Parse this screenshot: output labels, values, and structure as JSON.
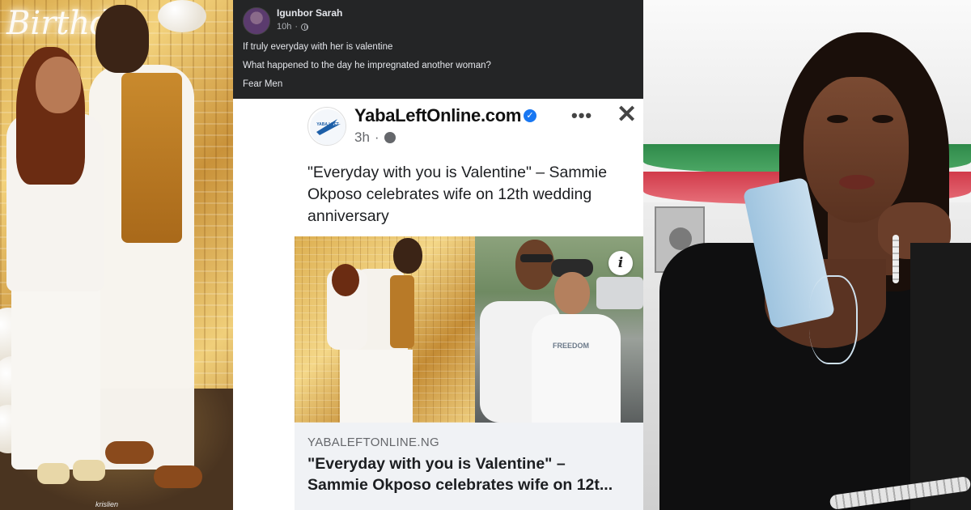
{
  "left_photo": {
    "sign_text": "Birthd",
    "credit": "krislien"
  },
  "facebook_post": {
    "author": "Igunbor Sarah",
    "time": "10h",
    "lines": [
      "If truly everyday with her is valentine",
      "What happened to the day he impregnated another woman?",
      "Fear Men"
    ]
  },
  "shared_post": {
    "page_name": "YabaLeftOnline.com",
    "logo_text": "YABA LEFT",
    "time": "3h",
    "more_icon": "more-dots-icon",
    "close_icon": "close-icon",
    "headline": "\"Everyday with you is Valentine\" – Sammie Okposo celebrates wife on 12th wedding anniversary",
    "image_info_icon": "i",
    "link": {
      "domain": "YABALEFTONLINE.NG",
      "title_line1": "\"Everyday with you is Valentine\" –",
      "title_line2": "Sammie Okposo celebrates wife on 12t..."
    },
    "photo_shirt_text": "FREEDOM"
  },
  "colors": {
    "fb_dark": "#242526",
    "verified_blue": "#1877f2",
    "link_bg": "#f0f2f5"
  }
}
